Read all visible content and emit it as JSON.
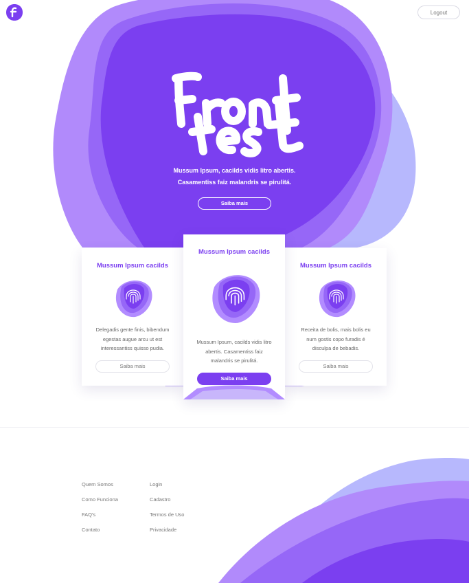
{
  "header": {
    "logo_letter": "f",
    "logout_label": "Logout"
  },
  "hero": {
    "wordmark_line1": "Front",
    "wordmark_line2": "test",
    "tagline_line1": "Mussum Ipsum, cacilds vidis litro abertis.",
    "tagline_line2": "Casamentiss faiz malandris se pirulitá.",
    "button_label": "Saiba mais"
  },
  "cards": [
    {
      "title": "Mussum Ipsum cacilds",
      "icon": "fingerprint-icon",
      "lines": [
        "Delegadis gente finis, bibendum",
        "egestas augue arcu ut est",
        "interessantiss quisso pudia."
      ],
      "button": "Saiba mais"
    },
    {
      "title": "Mussum Ipsum cacilds",
      "icon": "fingerprint-icon",
      "lines": [
        "Mussum Ipsum, cacilds vidis litro",
        "abertis. Casamentiss faiz",
        "malandris se pirulitá."
      ],
      "button": "Saiba mais"
    },
    {
      "title": "Mussum Ipsum cacilds",
      "icon": "fingerprint-icon",
      "lines": [
        "Receita de bolis, mais bolis eu",
        "num gostis copo furadis é",
        "disculpa de bebadis."
      ],
      "button": "Saiba mais"
    }
  ],
  "footer": {
    "col1": [
      "Quem Somos",
      "Como Funciona",
      "FAQ's",
      "Contato"
    ],
    "col2": [
      "Login",
      "Cadastro",
      "Termos de Uso",
      "Privacidade"
    ]
  },
  "colors": {
    "primary": "#7b3ff0",
    "light_purple": "#b28cff",
    "lavender": "#b8b8ff",
    "white": "#ffffff"
  }
}
